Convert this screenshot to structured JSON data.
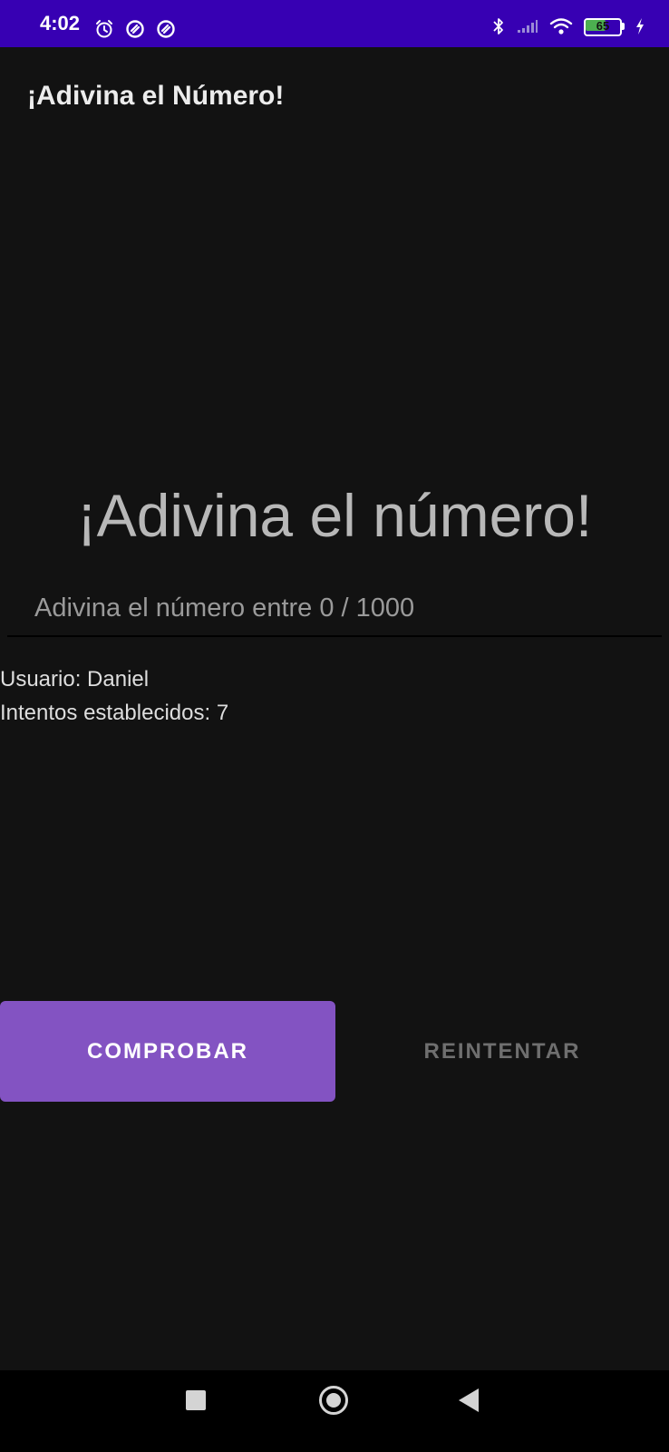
{
  "status_bar": {
    "time": "4:02",
    "left_icons": [
      "alarm-icon",
      "do-not-disturb-icon",
      "do-not-disturb-icon"
    ],
    "right_icons": [
      "bluetooth-icon",
      "signal-icon",
      "wifi-icon",
      "battery-icon",
      "charging-icon"
    ],
    "battery_level": "65",
    "battery_fraction": 0.65,
    "background_color": "#3700b3"
  },
  "app_bar": {
    "title": "¡Adivina el Número!"
  },
  "main": {
    "heading": "¡Adivina el número!",
    "guess_input": {
      "value": "",
      "placeholder": "Adivina el número entre 0 / 1000"
    },
    "user_info": "Usuario: Daniel",
    "attempts_info": "Intentos establecidos: 7"
  },
  "buttons": {
    "check_label": "COMPROBAR",
    "retry_label": "REINTENTAR",
    "check_color": "#8353c2"
  },
  "nav_bar": {
    "icons": [
      "recents-icon",
      "home-icon",
      "back-icon"
    ]
  }
}
